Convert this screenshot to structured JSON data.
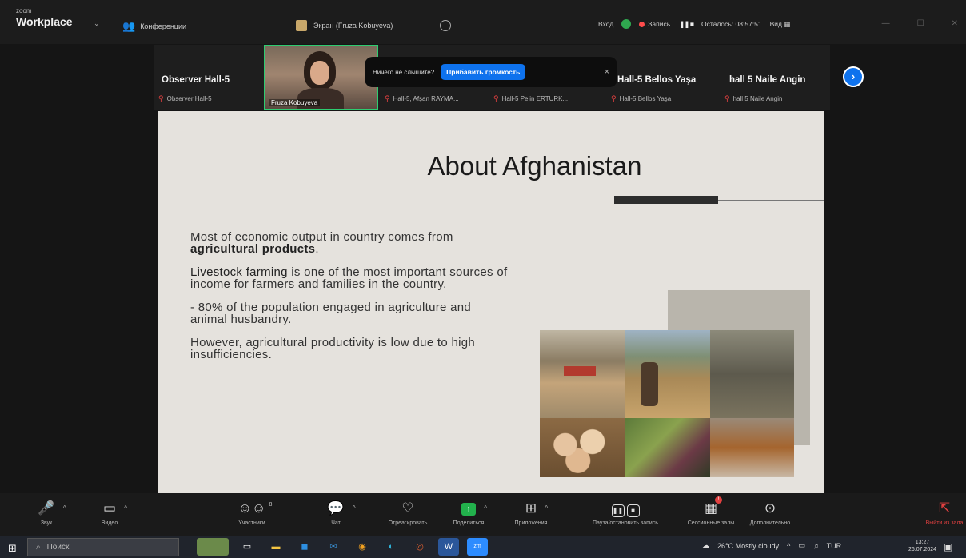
{
  "titlebar": {
    "brand_small": "zoom",
    "brand": "Workplace",
    "conference_label": "Конференции",
    "share_label": "Экран (Fruza Kobuyeva)",
    "login_label": "Вход",
    "recording_label": "Запись...",
    "remaining_label": "Осталось: 08:57:51",
    "view_label": "Вид"
  },
  "participants": [
    {
      "name": "Observer Hall-5",
      "sub": "Observer Hall-5"
    },
    {
      "name": "",
      "sub": "Hall-5, Afşan RAYMA..."
    },
    {
      "name": "",
      "sub": "Hall-5 Pelin ERTURK..."
    },
    {
      "name": "Hall-5 Bellos Yaşa",
      "sub": "Hall-5 Bellos Yaşa"
    },
    {
      "name": "hall 5 Naile Angin",
      "sub": "hall 5 Naile Angin"
    }
  ],
  "video_tile_label": "Fruza Kobuyeva",
  "notice": {
    "text": "Ничего не слышите?",
    "button": "Прибавить громкость",
    "close": "×"
  },
  "slide": {
    "title": "About Afghanistan",
    "p1_a": "Most of economic output in country comes from ",
    "p1_b": "agricultural products",
    "p1_c": ".",
    "p2_a": "Livestock farming ",
    "p2_b": "is one of the most important sources of income for farmers and families in the country.",
    "p3": "- 80% of the population engaged in agriculture and animal husbandry.",
    "p4": "However, agricultural productivity is low due to high insufficiencies."
  },
  "toolbar": {
    "audio": "Звук",
    "video": "Видео",
    "participants": "Участники",
    "participants_count": "8",
    "chat": "Чат",
    "react": "Отреагировать",
    "share": "Поделиться",
    "apps": "Приложения",
    "record": "Пауза/остановить запись",
    "rooms": "Сессионные залы",
    "more": "Дополнительно",
    "leave": "Выйти из зала"
  },
  "taskbar": {
    "search_placeholder": "Поиск",
    "weather": "26°C  Mostly cloudy",
    "lang": "TUR",
    "time": "13:27",
    "date": "26.07.2024"
  }
}
